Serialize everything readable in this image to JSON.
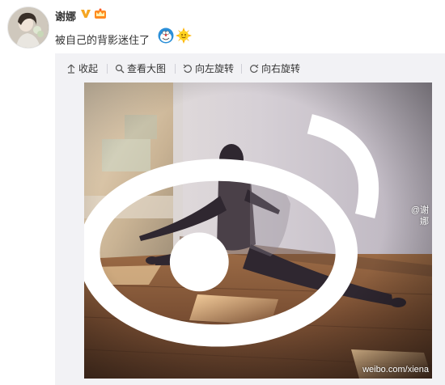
{
  "post": {
    "username": "谢娜",
    "text": "被自己的背影迷住了",
    "emoji": [
      "doraemon-emoji",
      "sun-face-emoji"
    ]
  },
  "toolbar": {
    "collapse_label": "收起",
    "view_large_label": "查看大图",
    "rotate_left_label": "向左旋转",
    "rotate_right_label": "向右旋转"
  },
  "photo": {
    "watermark_user": "@谢娜",
    "watermark_url": "weibo.com/xiena"
  },
  "colors": {
    "verified_badge": "#f5a623",
    "card_background": "#f2f2f5",
    "floor": "#8b5e3c",
    "wall": "#c9c3cc"
  }
}
